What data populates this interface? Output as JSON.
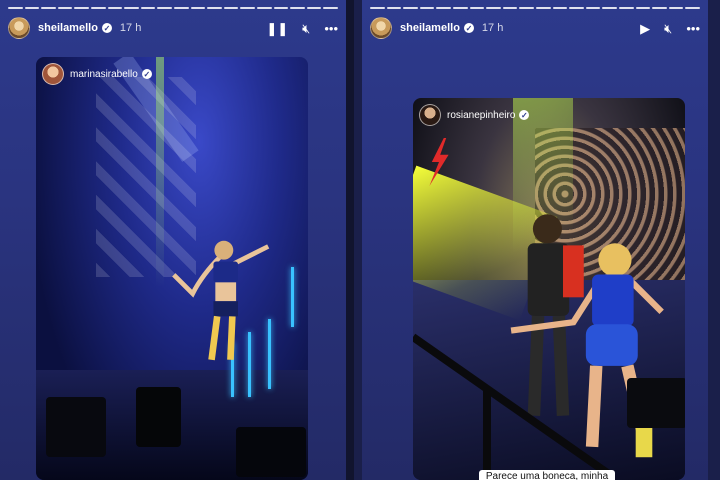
{
  "left_story": {
    "username": "sheilamello",
    "time": "17 h",
    "controls": {
      "pause_icon": "pause-icon",
      "mute_icon": "muted-icon",
      "more_icon": "more-icon"
    },
    "repost": {
      "username": "marinasirabello"
    }
  },
  "right_story": {
    "username": "sheilamello",
    "time": "17 h",
    "controls": {
      "play_icon": "play-icon",
      "mute_icon": "muted-icon",
      "more_icon": "more-icon"
    },
    "repost": {
      "username": "rosianepinheiro"
    },
    "caption": "Parece uma boneca, minha"
  },
  "colors": {
    "story_bg": "#2d3a8c",
    "neon": "#39c2ff",
    "beam": "#f5ff3a"
  }
}
